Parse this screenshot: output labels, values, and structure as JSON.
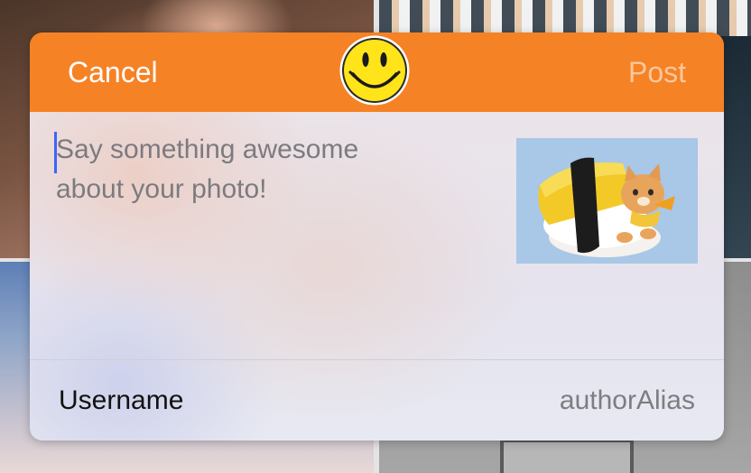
{
  "compose": {
    "cancel_label": "Cancel",
    "post_label": "Post",
    "logo_icon": "smiley-face-icon",
    "caption_placeholder": "Say something awesome\nabout your photo!",
    "caption_value": "",
    "photo_thumbnail": "sushi-cat-photo",
    "username_label": "Username",
    "username_value": "authorAlias"
  },
  "colors": {
    "nav_orange": "#f68226",
    "post_disabled": "#fbc79b",
    "caret_blue": "#3c63ff",
    "smiley_yellow": "#ffe41a"
  }
}
